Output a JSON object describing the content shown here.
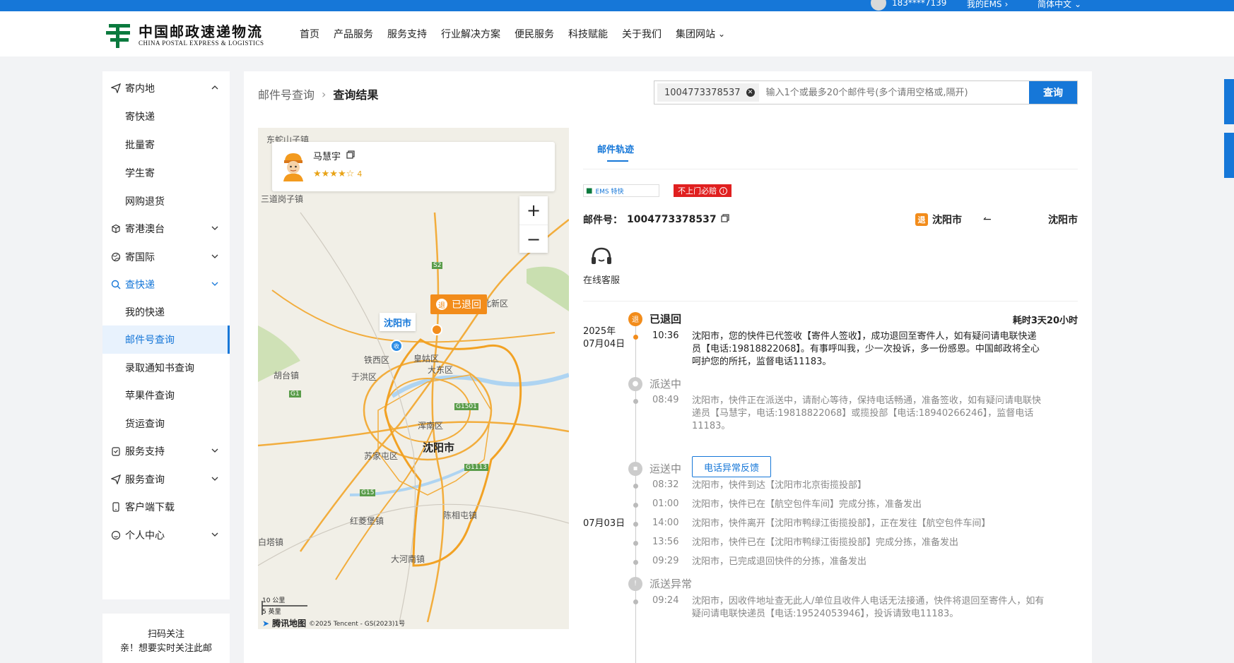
{
  "topbar": {
    "phone": "183****7139",
    "my_ems": "我的EMS",
    "language": "简体中文"
  },
  "logo": {
    "cn": "中国邮政速递物流",
    "en": "CHINA POSTAL EXPRESS & LOGISTICS"
  },
  "nav": [
    "首页",
    "产品服务",
    "服务支持",
    "行业解决方案",
    "便民服务",
    "科技赋能",
    "关于我们",
    "集团网站"
  ],
  "sidebar": {
    "items": [
      {
        "label": "寄内地",
        "icon": "send-icon"
      },
      {
        "label": "寄快递"
      },
      {
        "label": "批量寄"
      },
      {
        "label": "学生寄"
      },
      {
        "label": "网购退货"
      },
      {
        "label": "寄港澳台",
        "icon": "box-icon"
      },
      {
        "label": "寄国际",
        "icon": "globe-icon"
      },
      {
        "label": "查快递",
        "icon": "search-icon"
      },
      {
        "label": "我的快递"
      },
      {
        "label": "邮件号查询"
      },
      {
        "label": "录取通知书查询"
      },
      {
        "label": "苹果件查询"
      },
      {
        "label": "货运查询"
      },
      {
        "label": "服务支持",
        "icon": "service-icon"
      },
      {
        "label": "服务查询",
        "icon": "send-icon"
      },
      {
        "label": "客户端下载",
        "icon": "phone-icon"
      },
      {
        "label": "个人中心",
        "icon": "user-icon"
      }
    ],
    "qr_title": "扫码关注",
    "qr_text": "亲！想要实时关注此邮"
  },
  "breadcrumb": {
    "parent": "邮件号查询",
    "current": "查询结果"
  },
  "search": {
    "chip": "1004773378537",
    "placeholder": "输入1个或最多20个邮件号(多个请用空格或,隔开)",
    "button": "查询"
  },
  "courier": {
    "name": "马慧宇",
    "stars": "★★★★☆",
    "rating": "4"
  },
  "map": {
    "status_pin": "已退回",
    "city_pin": "沈阳市",
    "labels": [
      "东蛇山子镇",
      "三道岗子镇",
      "沈北新区",
      "铁西区",
      "皇姑区",
      "于洪区",
      "大东区",
      "胡台镇",
      "浑南区",
      "沈阳市",
      "苏家屯区",
      "红菱堡镇",
      "陈相屯镇",
      "大河南镇",
      "白塔镇"
    ],
    "highways": [
      "S2",
      "G1",
      "G1501",
      "G1113",
      "G15"
    ],
    "scale_km": "10 公里",
    "scale_mi": "5 英里",
    "provider": "腾讯地图",
    "copyright": "©2025 Tencent - GS(2023)1号"
  },
  "detail": {
    "tab": "邮件轨迹",
    "brand": "EMS 特快",
    "badge": "不上门必赔",
    "mail_label": "邮件号：",
    "mail_no": "1004773378537",
    "route_from": "沈阳市",
    "route_to": "沈阳市",
    "route_tag": "退",
    "cs_label": "在线客服",
    "duration": "耗时3天20小时",
    "feedback_button": "电话异常反馈",
    "dates": {
      "d1_year": "2025年",
      "d1_day": "07月04日",
      "d2": "07月03日"
    },
    "statuses": [
      "已退回",
      "派送中",
      "运送中",
      "派送异常"
    ],
    "events": [
      {
        "time": "10:36",
        "text": "沈阳市，您的快件已代签收【寄件人签收】，成功退回至寄件人，如有疑问请电联快递员【电话:19818822068】。有事呼叫我，少一次投诉，多一份感恩。中国邮政将全心呵护您的所托，监督电话11183。"
      },
      {
        "time": "08:49",
        "text": "沈阳市，快件正在派送中，请耐心等待，保持电话畅通，准备签收，如有疑问请电联快递员【马慧宇，电话:19818822068】或揽投部【电话:18940266246】，监督电话11183。"
      },
      {
        "time": "08:32",
        "text": "沈阳市，快件到达【沈阳市北京街揽投部】"
      },
      {
        "time": "01:00",
        "text": "沈阳市，快件已在【航空包件车间】完成分拣，准备发出"
      },
      {
        "time": "14:00",
        "text": "沈阳市，快件离开【沈阳市鸭绿江街揽投部】，正在发往【航空包件车间】"
      },
      {
        "time": "13:56",
        "text": "沈阳市，快件已在【沈阳市鸭绿江街揽投部】完成分拣，准备发出"
      },
      {
        "time": "09:29",
        "text": "沈阳市，已完成退回快件的分拣，准备发出"
      },
      {
        "time": "09:24",
        "text": "沈阳市，因收件地址查无此人/单位且收件人电话无法接通，快件将退回至寄件人，如有疑问请电联快递员【电话:19524053946】，投诉请致电11183。"
      }
    ]
  }
}
